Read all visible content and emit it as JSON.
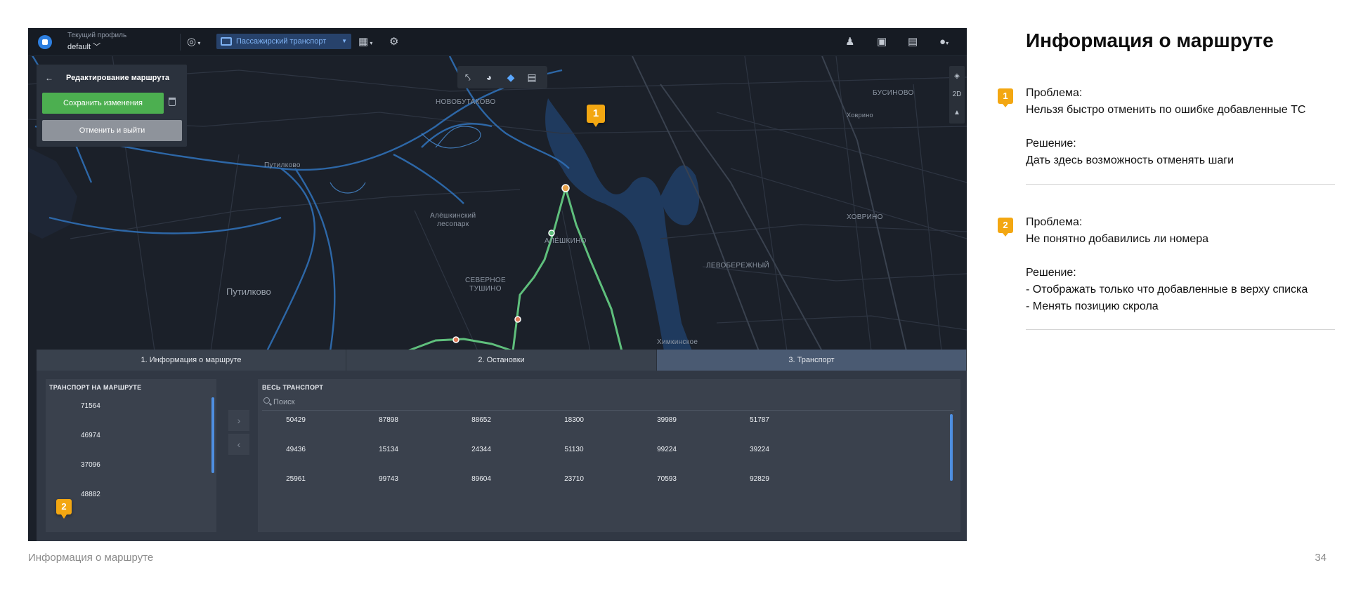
{
  "topbar": {
    "profile_caption": "Текущий профиль",
    "profile_value": "default ﹀",
    "transport_selector": "Пассажирский транспорт"
  },
  "edit_panel": {
    "title": "Редактирование маршрута",
    "save_label": "Сохранить изменения",
    "cancel_label": "Отменить и выйти"
  },
  "map": {
    "labels": {
      "novobutakovo": "НОВОБУТАКОВО",
      "busino": "БУСИНОВО",
      "khovrino_small": "Ховрино",
      "putilkovo_small": "Путилково",
      "les": "Алёшкинский\nлесопарк",
      "aleshkino": "АЛЁШКИНО",
      "khovrino": "ХОВРИНО",
      "severnoe": "СЕВЕРНОЕ\nТУШИНО",
      "levober": "ЛЕВОБЕРЕЖНЫЙ",
      "putilkovo": "Путилково",
      "khimki": "Химкинское"
    },
    "controls": {
      "mode_2d": "2D"
    }
  },
  "tabs": [
    {
      "label": "1. Информация о маршруте"
    },
    {
      "label": "2. Остановки"
    },
    {
      "label": "3. Транспорт"
    }
  ],
  "route_transport": {
    "title": "ТРАНСПОРТ НА МАРШРУТЕ",
    "items": [
      "71564",
      "46974",
      "37096",
      "48882"
    ]
  },
  "all_transport": {
    "title": "ВЕСЬ ТРАНСПОРТ",
    "search_placeholder": "Поиск",
    "rows": [
      [
        "50429",
        "87898",
        "88652",
        "18300",
        "39989",
        "51787"
      ],
      [
        "49436",
        "15134",
        "24344",
        "51130",
        "99224",
        "39224"
      ],
      [
        "25961",
        "99743",
        "89604",
        "23710",
        "70593",
        "92829"
      ]
    ]
  },
  "markers": {
    "one": "1",
    "two": "2"
  },
  "info": {
    "title": "Информация о маршруте",
    "notes": [
      {
        "num": "1",
        "problem_label": "Проблема:",
        "problem": "Нельзя быстро отменить по ошибке добавленные ТС",
        "solution_label": "Решение:",
        "solution": [
          "Дать здесь возможность отменять шаги"
        ]
      },
      {
        "num": "2",
        "problem_label": "Проблема:",
        "problem": "Не понятно добавились ли номера",
        "solution_label": "Решение:",
        "solution": [
          "- Отображать только что добавленные в верху списка",
          "- Менять позицию скрола"
        ]
      }
    ]
  },
  "footer": {
    "title": "Информация о маршруте",
    "page": "34"
  },
  "colors": {
    "accent": "#f3a712",
    "save": "#4caf50",
    "route": "#5fbf7c",
    "active_tab": "#4a5a72",
    "map_bg": "#1b2029",
    "water": "#1f3a5e"
  }
}
